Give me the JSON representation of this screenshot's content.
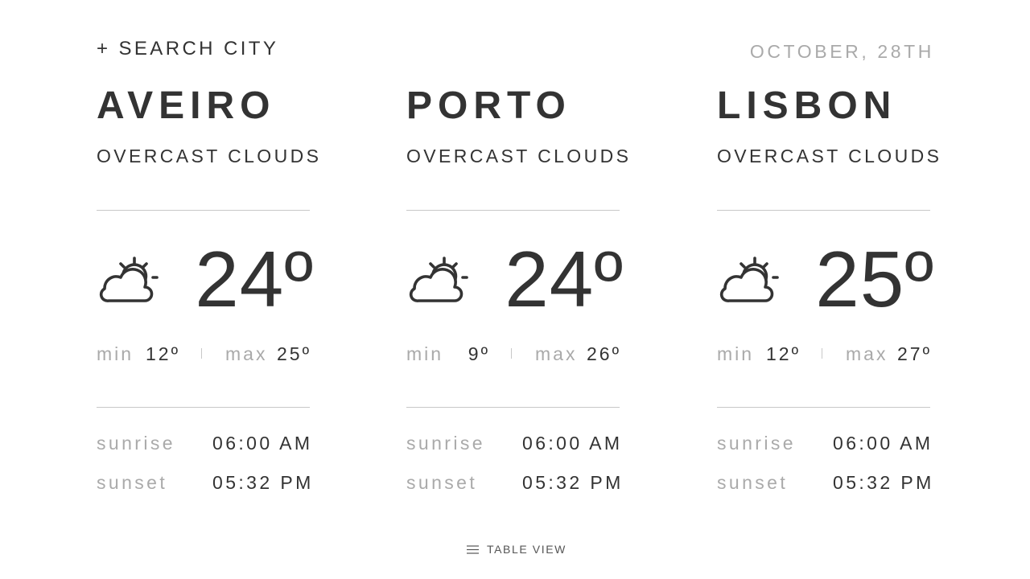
{
  "header": {
    "search_label": "+ SEARCH CITY",
    "date": "OCTOBER, 28TH"
  },
  "cities": [
    {
      "name": "AVEIRO",
      "condition": "OVERCAST CLOUDS",
      "icon": "partly-cloudy-icon",
      "temp": "24º",
      "min_label": "min",
      "min": "12º",
      "max_label": "max",
      "max": "25º",
      "sunrise_label": "sunrise",
      "sunrise": "06:00 AM",
      "sunset_label": "sunset",
      "sunset": "05:32 PM"
    },
    {
      "name": "PORTO",
      "condition": "OVERCAST CLOUDS",
      "icon": "partly-cloudy-icon",
      "temp": "24º",
      "min_label": "min",
      "min": "9º",
      "max_label": "max",
      "max": "26º",
      "sunrise_label": "sunrise",
      "sunrise": "06:00 AM",
      "sunset_label": "sunset",
      "sunset": "05:32 PM"
    },
    {
      "name": "LISBON",
      "condition": "OVERCAST CLOUDS",
      "icon": "partly-cloudy-icon",
      "temp": "25º",
      "min_label": "min",
      "min": "12º",
      "max_label": "max",
      "max": "27º",
      "sunrise_label": "sunrise",
      "sunrise": "06:00 AM",
      "sunset_label": "sunset",
      "sunset": "05:32 PM"
    }
  ],
  "footer": {
    "table_view_label": "TABLE VIEW",
    "icon": "menu-icon"
  },
  "colors": {
    "text": "#333333",
    "muted": "#aaaaaa",
    "divider": "#c8c8c8",
    "background": "#ffffff"
  }
}
